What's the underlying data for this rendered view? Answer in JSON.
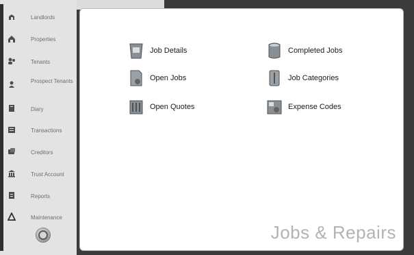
{
  "sidebar": {
    "items": [
      {
        "label": "Landlords",
        "icon": "landlords-icon"
      },
      {
        "label": "Properties",
        "icon": "properties-icon"
      },
      {
        "label": "Tenants",
        "icon": "tenants-icon"
      },
      {
        "label": "Prospect Tenants",
        "icon": "prospect-tenants-icon"
      },
      {
        "label": "Diary",
        "icon": "diary-icon"
      },
      {
        "label": "Transactions",
        "icon": "transactions-icon"
      },
      {
        "label": "Creditors",
        "icon": "creditors-icon"
      },
      {
        "label": "Trust Account",
        "icon": "trust-account-icon"
      },
      {
        "label": "Reports",
        "icon": "reports-icon"
      },
      {
        "label": "Maintenance",
        "icon": "maintenance-icon"
      }
    ],
    "power_icon": "power-icon"
  },
  "panel": {
    "title": "Jobs & Repairs",
    "menu": {
      "job_details": "Job Details",
      "open_jobs": "Open Jobs",
      "open_quotes": "Open Quotes",
      "completed_jobs": "Completed Jobs",
      "job_categories": "Job Categories",
      "expense_codes": "Expense Codes"
    }
  },
  "colors": {
    "background": "#3b3b3b",
    "sidebar": "#e3e3e3",
    "panel": "#ffffff",
    "title": "#b3b3b3"
  }
}
